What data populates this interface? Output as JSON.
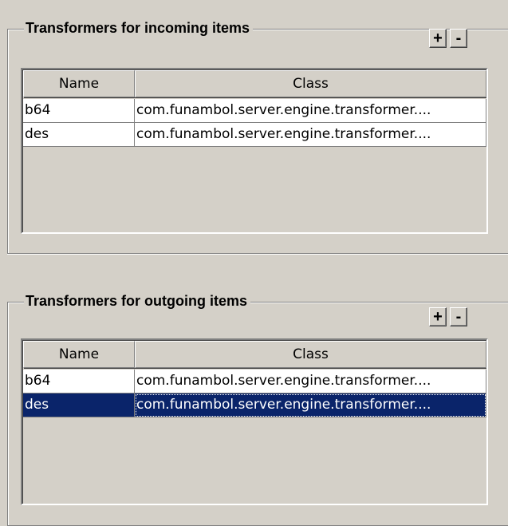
{
  "incoming": {
    "title": "Transformers for incoming items",
    "add_label": "+",
    "remove_label": "-",
    "columns": [
      "Name",
      "Class"
    ],
    "rows": [
      {
        "name": "b64",
        "class": "com.funambol.server.engine.transformer...."
      },
      {
        "name": "des",
        "class": "com.funambol.server.engine.transformer...."
      }
    ]
  },
  "outgoing": {
    "title": "Transformers for outgoing items",
    "add_label": "+",
    "remove_label": "-",
    "columns": [
      "Name",
      "Class"
    ],
    "rows": [
      {
        "name": "b64",
        "class": "com.funambol.server.engine.transformer...."
      },
      {
        "name": "des",
        "class": "com.funambol.server.engine.transformer....",
        "selected": true
      }
    ]
  },
  "colors": {
    "background": "#d4d0c8",
    "selection": "#0a246a",
    "cell_background": "#ffffff"
  }
}
